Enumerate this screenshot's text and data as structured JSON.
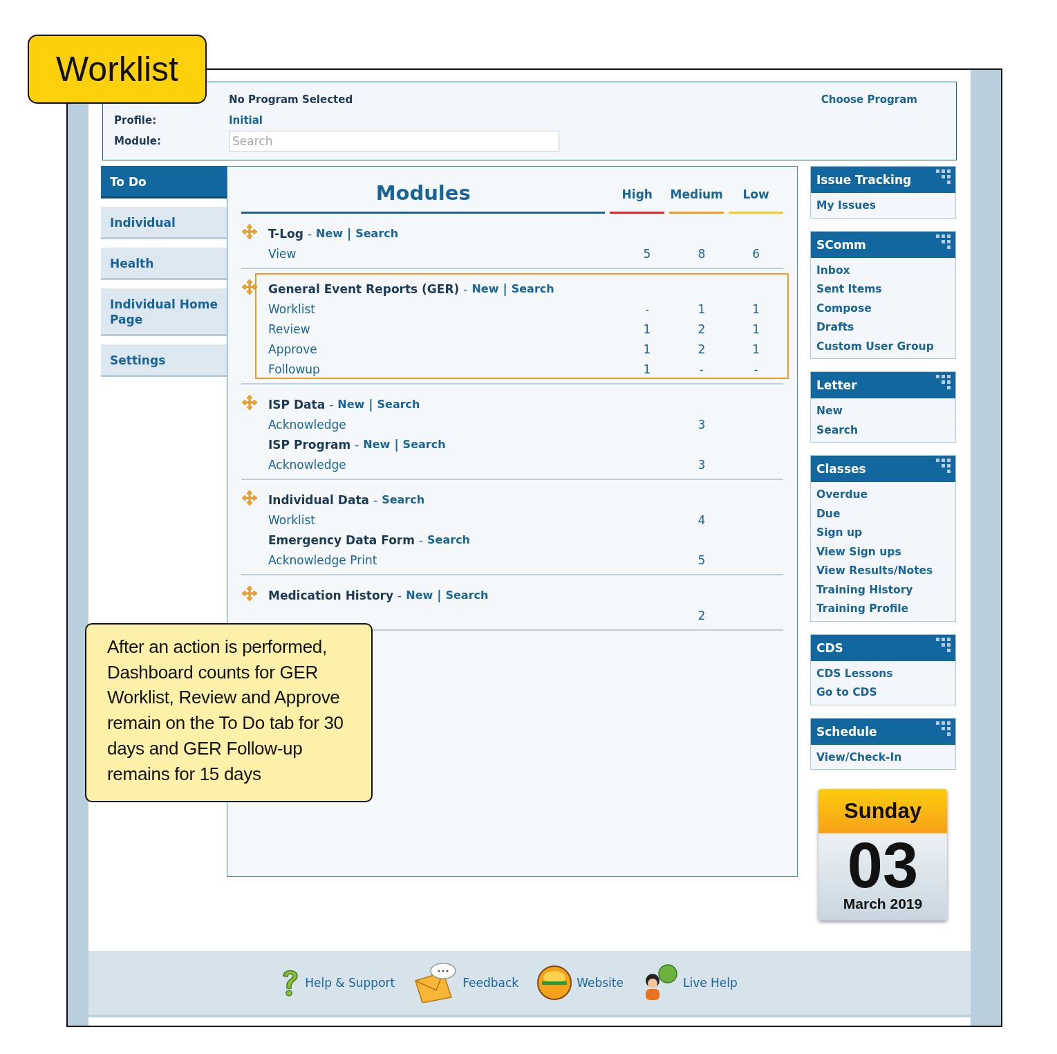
{
  "callouts": [
    {
      "kind": "tag",
      "text": "Worklist"
    },
    {
      "kind": "note",
      "text": "After an action is performed, Dashboard counts for GER Worklist, Review and Approve remain on the To Do tab for 30 days and GER Follow-up remains for 15 days"
    }
  ],
  "header": {
    "program": "No Program Selected",
    "choose": "Choose Program",
    "profile_label": "Profile:",
    "profile": "Initial",
    "module_label": "Module:",
    "search": {
      "placeholder": "Search"
    }
  },
  "tabs": [
    {
      "label": "To Do",
      "selected": true
    },
    {
      "label": "Individual",
      "selected": false
    },
    {
      "label": "Health",
      "selected": false
    },
    {
      "label": "Individual Home Page",
      "selected": false
    },
    {
      "label": "Settings",
      "selected": false
    }
  ],
  "modules": {
    "title": "Modules",
    "columns": [
      {
        "label": "High",
        "color": "#e3262b"
      },
      {
        "label": "Medium",
        "color": "#f39a26"
      },
      {
        "label": "Low",
        "color": "#f7c81e"
      }
    ],
    "groups": [
      {
        "highlighted": false,
        "rows": [
          {
            "kind": "heading",
            "title": "T-Log",
            "dash": "-",
            "links": [
              "New",
              "Search"
            ],
            "bar": "|"
          },
          {
            "kind": "count",
            "label": "View",
            "values": {
              "high": "5",
              "medium": "8",
              "low": "6"
            }
          }
        ]
      },
      {
        "highlighted": true,
        "rows": [
          {
            "kind": "heading",
            "title": "General Event Reports (GER)",
            "dash": "-",
            "links": [
              "New",
              "Search"
            ],
            "bar": "|"
          },
          {
            "kind": "count",
            "label": "Worklist",
            "values": {
              "high": "-",
              "medium": "1",
              "low": "1"
            }
          },
          {
            "kind": "count",
            "label": "Review",
            "values": {
              "high": "1",
              "medium": "2",
              "low": "1"
            }
          },
          {
            "kind": "count",
            "label": "Approve",
            "values": {
              "high": "1",
              "medium": "2",
              "low": "1"
            }
          },
          {
            "kind": "count",
            "label": "Followup",
            "values": {
              "high": "1",
              "medium": "-",
              "low": "-"
            }
          }
        ]
      },
      {
        "highlighted": false,
        "rows": [
          {
            "kind": "heading",
            "title": "ISP Data",
            "dash": "-",
            "links": [
              "New",
              "Search"
            ],
            "bar": "|"
          },
          {
            "kind": "count",
            "label": "Acknowledge",
            "values": {
              "medium": "3"
            }
          },
          {
            "kind": "heading",
            "title": "ISP Program",
            "dash": "-",
            "links": [
              "New",
              "Search"
            ],
            "bar": "|"
          },
          {
            "kind": "count",
            "label": "Acknowledge",
            "values": {
              "medium": "3"
            }
          }
        ]
      },
      {
        "highlighted": false,
        "rows": [
          {
            "kind": "heading",
            "title": "Individual Data",
            "dash": "-",
            "links": [
              "Search"
            ]
          },
          {
            "kind": "count",
            "label": "Worklist",
            "values": {
              "medium": "4"
            }
          },
          {
            "kind": "heading",
            "title": "Emergency Data Form",
            "dash": "-",
            "links": [
              "Search"
            ]
          },
          {
            "kind": "count",
            "label": "Acknowledge Print",
            "values": {
              "medium": "5"
            }
          }
        ]
      },
      {
        "highlighted": false,
        "rows": [
          {
            "kind": "heading",
            "title": "Medication History",
            "dash": "-",
            "links": [
              "New",
              "Search"
            ],
            "bar": "|"
          },
          {
            "kind": "count",
            "values": {
              "medium": "2"
            }
          }
        ]
      }
    ]
  },
  "panels": [
    {
      "title": "Issue Tracking",
      "links": [
        "My Issues"
      ]
    },
    {
      "title": "SComm",
      "links": [
        "Inbox",
        "Sent Items",
        "Compose",
        "Drafts",
        "Custom User Group"
      ]
    },
    {
      "title": "Letter",
      "links": [
        "New",
        "Search"
      ]
    },
    {
      "title": "Classes",
      "links": [
        "Overdue",
        "Due",
        "Sign up",
        "View Sign ups",
        "View Results/Notes",
        "Training History",
        "Training Profile"
      ]
    },
    {
      "title": "CDS",
      "links": [
        "CDS Lessons",
        "Go to CDS"
      ]
    },
    {
      "title": "Schedule",
      "links": [
        "View/Check-In"
      ]
    }
  ],
  "calendar": {
    "weekday": "Sunday",
    "day": "03",
    "month": "March 2019"
  },
  "footer": [
    {
      "kind": "help",
      "label": "Help & Support"
    },
    {
      "kind": "feedback",
      "label": "Feedback"
    },
    {
      "kind": "website",
      "label": "Website"
    },
    {
      "kind": "live",
      "label": "Live Help"
    }
  ]
}
